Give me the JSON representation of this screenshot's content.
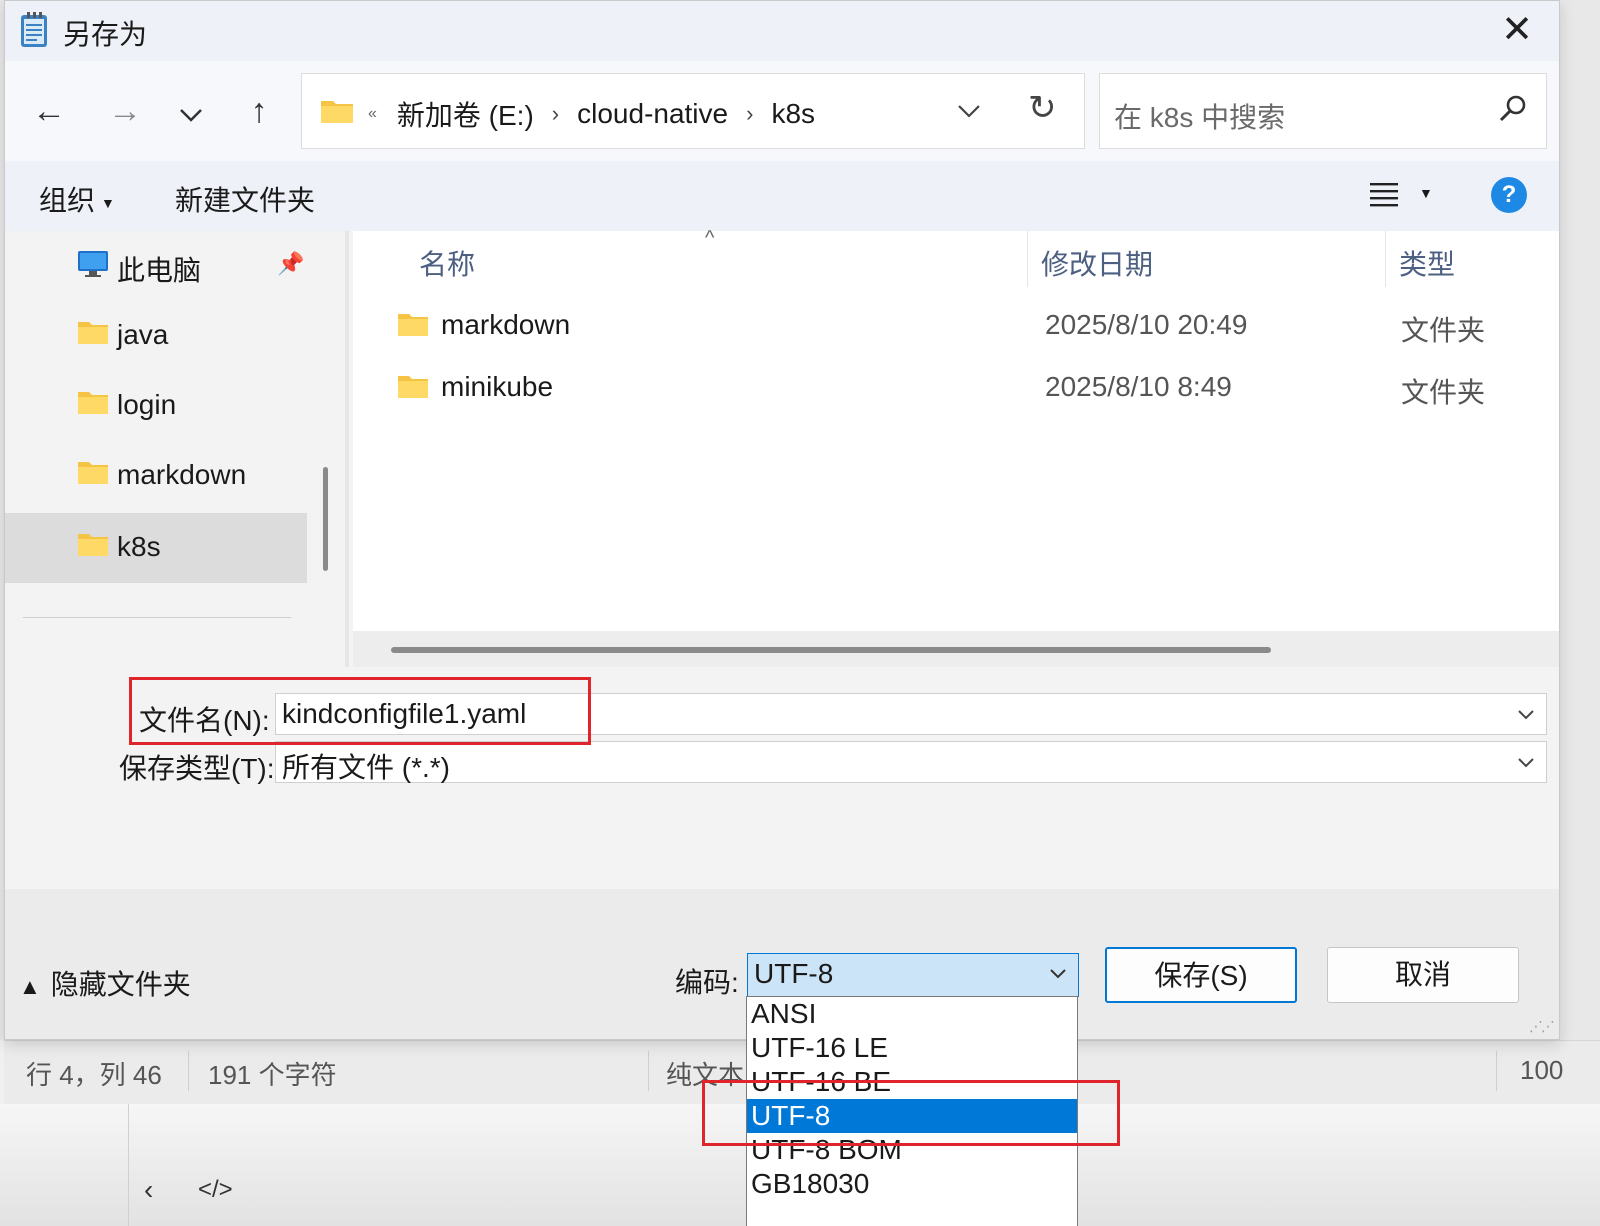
{
  "window": {
    "title": "另存为"
  },
  "nav": {
    "back": "←",
    "forward": "→",
    "recent": "⌄",
    "up": "↑"
  },
  "address": {
    "crumbs": [
      "新加卷 (E:)",
      "cloud-native",
      "k8s"
    ]
  },
  "search": {
    "placeholder": "在 k8s 中搜索"
  },
  "toolbar": {
    "organize": "组织",
    "new_folder": "新建文件夹",
    "help": "?"
  },
  "sidebar": {
    "items": [
      {
        "label": "此电脑",
        "icon": "computer-icon"
      },
      {
        "label": "java",
        "icon": "folder-icon"
      },
      {
        "label": "login",
        "icon": "folder-icon"
      },
      {
        "label": "markdown",
        "icon": "folder-icon"
      },
      {
        "label": "k8s",
        "icon": "folder-icon",
        "selected": true
      }
    ]
  },
  "filelist": {
    "columns": [
      "名称",
      "修改日期",
      "类型"
    ],
    "rows": [
      {
        "name": "markdown",
        "date": "2025/8/10 20:49",
        "type": "文件夹"
      },
      {
        "name": "minikube",
        "date": "2025/8/10 8:49",
        "type": "文件夹"
      }
    ]
  },
  "fields": {
    "filename_label": "文件名(N):",
    "filename_value": "kindconfigfile1.yaml",
    "filetype_label": "保存类型(T):",
    "filetype_value": "所有文件  (*.*)"
  },
  "footer": {
    "hide_folders": "隐藏文件夹",
    "encoding_label": "编码:",
    "encoding_value": "UTF-8",
    "save": "保存(S)",
    "cancel": "取消"
  },
  "encoding_options": [
    "ANSI",
    "UTF-16 LE",
    "UTF-16 BE",
    "UTF-8",
    "UTF-8 BOM",
    "GB18030"
  ],
  "encoding_selected_index": 3,
  "background_status": {
    "position": "行 4，列 46",
    "chars": "191 个字符",
    "format": "纯文本",
    "zoom": "100"
  },
  "colors": {
    "accent": "#0078d4",
    "highlight_box": "#e0242b",
    "folder": "#f6c445"
  }
}
